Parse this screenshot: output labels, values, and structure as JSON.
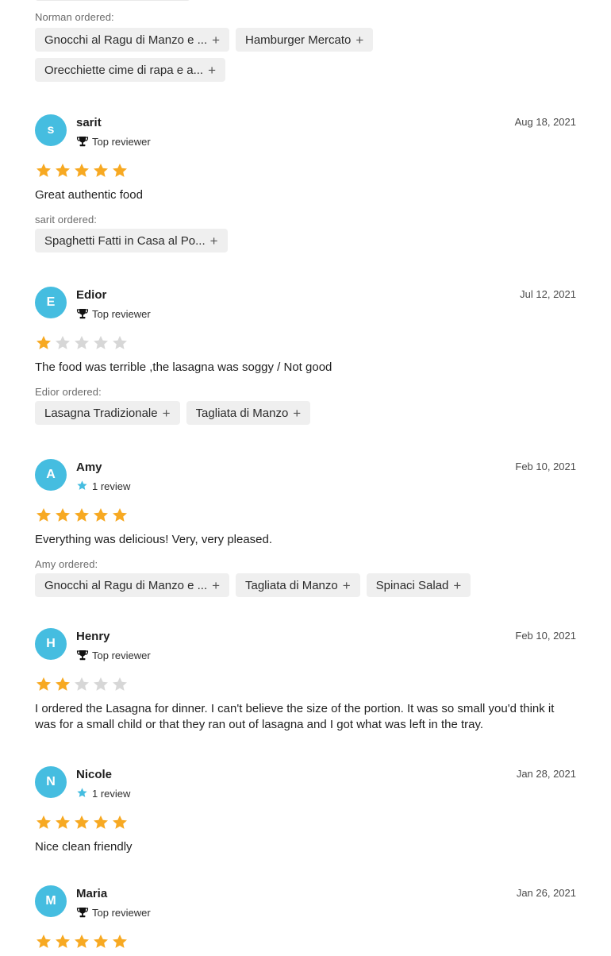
{
  "colors": {
    "accent": "#45bde0",
    "star_on": "#f7a922",
    "star_off": "#d7d7d7",
    "chip_bg": "#efefef"
  },
  "top_section": {
    "ordered_label": "Norman ordered:",
    "items": [
      {
        "label": "Gnocchi al Ragu di Manzo e ...",
        "icon": "plus-icon"
      },
      {
        "label": "Hamburger Mercato",
        "icon": "plus-icon"
      },
      {
        "label": "Orecchiette cime di rapa e a...",
        "icon": "plus-icon"
      }
    ]
  },
  "reviews": [
    {
      "initial": "s",
      "name": "sarit",
      "badge": "Top reviewer",
      "badge_icon": "trophy-icon",
      "date": "Aug 18, 2021",
      "rating": 5,
      "text": "Great authentic food",
      "ordered_label": "sarit ordered:",
      "items": [
        "Spaghetti Fatti in Casa al Po..."
      ]
    },
    {
      "initial": "E",
      "name": "Edior",
      "badge": "Top reviewer",
      "badge_icon": "trophy-icon",
      "date": "Jul 12, 2021",
      "rating": 1,
      "text": "The food was terrible ,the lasagna was soggy / Not good",
      "ordered_label": "Edior ordered:",
      "items": [
        "Lasagna Tradizionale",
        "Tagliata di Manzo"
      ]
    },
    {
      "initial": "A",
      "name": "Amy",
      "badge": "1 review",
      "badge_icon": "star-icon",
      "date": "Feb 10, 2021",
      "rating": 5,
      "text": "Everything was delicious! Very, very pleased.",
      "ordered_label": "Amy ordered:",
      "items": [
        "Gnocchi al Ragu di Manzo e ...",
        "Tagliata di Manzo",
        "Spinaci Salad"
      ]
    },
    {
      "initial": "H",
      "name": "Henry",
      "badge": "Top reviewer",
      "badge_icon": "trophy-icon",
      "date": "Feb 10, 2021",
      "rating": 2,
      "text": "I ordered the Lasagna for dinner. I can't believe the size of the portion. It was so small you'd think it was for a small child or that they ran out of lasagna and I got what was left in the tray."
    },
    {
      "initial": "N",
      "name": "Nicole",
      "badge": "1 review",
      "badge_icon": "star-icon",
      "date": "Jan 28, 2021",
      "rating": 5,
      "text": "Nice clean friendly"
    },
    {
      "initial": "M",
      "name": "Maria",
      "badge": "Top reviewer",
      "badge_icon": "trophy-icon",
      "date": "Jan 26, 2021",
      "rating": 5
    }
  ]
}
